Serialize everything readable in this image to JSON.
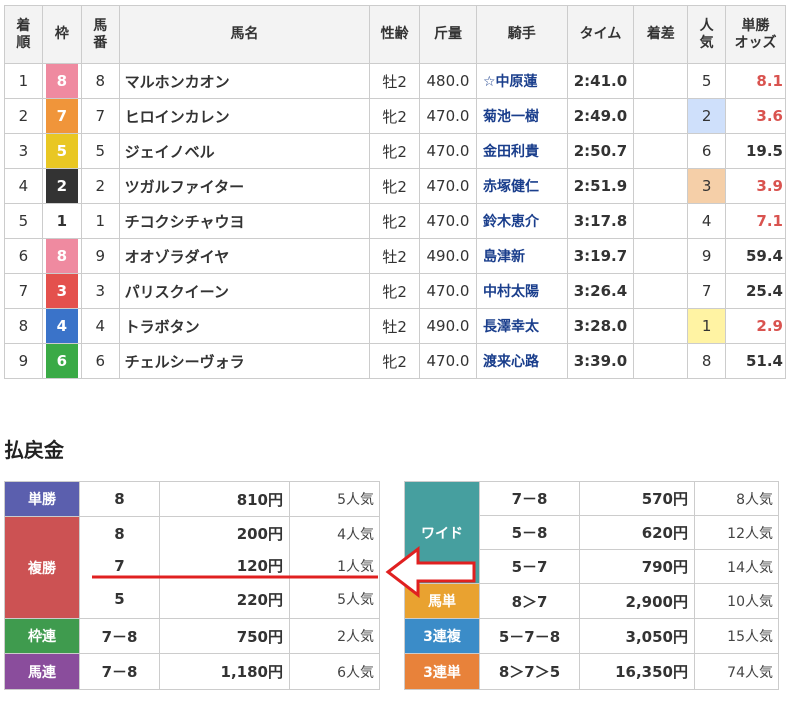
{
  "results": {
    "headers": {
      "rank": [
        "着",
        "順"
      ],
      "frame": "枠",
      "number": [
        "馬",
        "番"
      ],
      "horse": "馬名",
      "sex_age": "性齢",
      "weight": "斤量",
      "jockey": "騎手",
      "time": "タイム",
      "margin": "着差",
      "popularity": [
        "人",
        "気"
      ],
      "odds": [
        "単勝",
        "オッズ"
      ]
    },
    "rows": [
      {
        "rank": "1",
        "frame": "8",
        "number": "8",
        "horse": "マルホンカオン",
        "sex_age": "牡2",
        "weight": "480.0",
        "jockey": "☆中原蓮",
        "time": "2:41.0",
        "margin": "",
        "pop": "5",
        "odds": "8.1"
      },
      {
        "rank": "2",
        "frame": "7",
        "number": "7",
        "horse": "ヒロインカレン",
        "sex_age": "牝2",
        "weight": "470.0",
        "jockey": "菊池一樹",
        "time": "2:49.0",
        "margin": "",
        "pop": "2",
        "odds": "3.6"
      },
      {
        "rank": "3",
        "frame": "5",
        "number": "5",
        "horse": "ジェイノベル",
        "sex_age": "牝2",
        "weight": "470.0",
        "jockey": "金田利貴",
        "time": "2:50.7",
        "margin": "",
        "pop": "6",
        "odds": "19.5"
      },
      {
        "rank": "4",
        "frame": "2",
        "number": "2",
        "horse": "ツガルファイター",
        "sex_age": "牝2",
        "weight": "470.0",
        "jockey": "赤塚健仁",
        "time": "2:51.9",
        "margin": "",
        "pop": "3",
        "odds": "3.9"
      },
      {
        "rank": "5",
        "frame": "1",
        "number": "1",
        "horse": "チコクシチャウヨ",
        "sex_age": "牝2",
        "weight": "470.0",
        "jockey": "鈴木恵介",
        "time": "3:17.8",
        "margin": "",
        "pop": "4",
        "odds": "7.1"
      },
      {
        "rank": "6",
        "frame": "8",
        "number": "9",
        "horse": "オオゾラダイヤ",
        "sex_age": "牡2",
        "weight": "490.0",
        "jockey": "島津新",
        "time": "3:19.7",
        "margin": "",
        "pop": "9",
        "odds": "59.4"
      },
      {
        "rank": "7",
        "frame": "3",
        "number": "3",
        "horse": "パリスクイーン",
        "sex_age": "牝2",
        "weight": "470.0",
        "jockey": "中村太陽",
        "time": "3:26.4",
        "margin": "",
        "pop": "7",
        "odds": "25.4"
      },
      {
        "rank": "8",
        "frame": "4",
        "number": "4",
        "horse": "トラボタン",
        "sex_age": "牡2",
        "weight": "490.0",
        "jockey": "長澤幸太",
        "time": "3:28.0",
        "margin": "",
        "pop": "1",
        "odds": "2.9"
      },
      {
        "rank": "9",
        "frame": "6",
        "number": "6",
        "horse": "チェルシーヴォラ",
        "sex_age": "牝2",
        "weight": "470.0",
        "jockey": "渡来心路",
        "time": "3:39.0",
        "margin": "",
        "pop": "8",
        "odds": "51.4"
      }
    ]
  },
  "payout": {
    "title": "払戻金",
    "left": {
      "tansho": {
        "label": "単勝",
        "comb": "8",
        "yen": "810円",
        "pop": "5人気"
      },
      "fukusho": {
        "label": "複勝",
        "rows": [
          {
            "comb": "8",
            "yen": "200円",
            "pop": "4人気"
          },
          {
            "comb": "7",
            "yen": "120円",
            "pop": "1人気"
          },
          {
            "comb": "5",
            "yen": "220円",
            "pop": "5人気"
          }
        ]
      },
      "wakuren": {
        "label": "枠連",
        "comb": "7－8",
        "yen": "750円",
        "pop": "2人気"
      },
      "umaren": {
        "label": "馬連",
        "comb": "7－8",
        "yen": "1,180円",
        "pop": "6人気"
      }
    },
    "right": {
      "wide": {
        "label": "ワイド",
        "rows": [
          {
            "comb": "7－8",
            "yen": "570円",
            "pop": "8人気"
          },
          {
            "comb": "5－8",
            "yen": "620円",
            "pop": "12人気"
          },
          {
            "comb": "5－7",
            "yen": "790円",
            "pop": "14人気"
          }
        ]
      },
      "umatan": {
        "label": "馬単",
        "comb": "8＞7",
        "yen": "2,900円",
        "pop": "10人気"
      },
      "sanrenpuku": {
        "label": "3連複",
        "comb": "5－7－8",
        "yen": "3,050円",
        "pop": "15人気"
      },
      "sanrentan": {
        "label": "3連単",
        "comb": "8＞7＞5",
        "yen": "16,350円",
        "pop": "74人気"
      }
    }
  },
  "colors": {
    "frame_1": "#ffffff",
    "frame_2": "#333333",
    "frame_3": "#e4514d",
    "frame_4": "#3a73c9",
    "frame_5": "#e9c723",
    "frame_6": "#3aaa46",
    "frame_7": "#f0953a",
    "frame_8": "#ef8aa0",
    "pop_1": "#fff3a3",
    "pop_2": "#cfe0fb",
    "pop_3": "#f5cfa8",
    "odds_fav": "#d9534f",
    "lbl_tansho": "#5b5fae",
    "lbl_fukusho": "#cc5253",
    "lbl_wakuren": "#3f9b4e",
    "lbl_umaren": "#8a4d9c",
    "lbl_wide": "#469f9f",
    "lbl_umatan": "#e9a230",
    "lbl_sanrenpuku": "#3b8cc8",
    "lbl_sanrentan": "#e8823a",
    "annotation": "#e02020"
  }
}
